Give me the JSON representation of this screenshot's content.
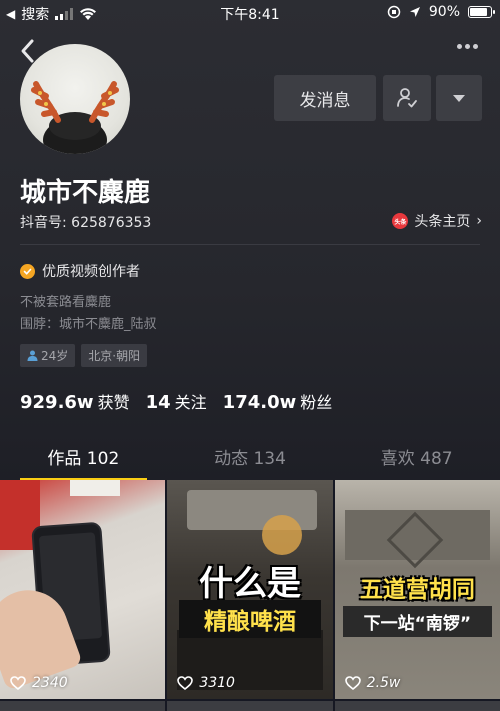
{
  "status_bar": {
    "left_label": "搜索",
    "time": "下午8:41",
    "battery_text": "90%",
    "battery_level": 0.9
  },
  "profile": {
    "nickname": "城市不麋鹿",
    "douyin_id": "抖音号: 625876353",
    "toutiao_label": "头条主页",
    "toutiao_logo_text": "头条",
    "verified_label": "优质视频创作者",
    "bio_line1": "不被套路看麋鹿",
    "bio_line2": "围脖：城市不麋鹿_陆叔",
    "tags": [
      "24岁",
      "北京·朝阳"
    ]
  },
  "actions": {
    "message_label": "发消息"
  },
  "stats": [
    {
      "num": "929.6w",
      "label": "获赞"
    },
    {
      "num": "14",
      "label": "关注"
    },
    {
      "num": "174.0w",
      "label": "粉丝"
    }
  ],
  "tabs": [
    {
      "label": "作品 102",
      "active": true
    },
    {
      "label": "动态 134",
      "active": false
    },
    {
      "label": "喜欢 487",
      "active": false
    }
  ],
  "videos": [
    {
      "likes": "2340",
      "title_line1": "",
      "title_line2": ""
    },
    {
      "likes": "3310",
      "title_line1": "什么是",
      "title_line2": "精酿啤酒"
    },
    {
      "likes": "2.5w",
      "title_line1": "五道营胡同",
      "title_line2": "下一站“南锣”"
    }
  ],
  "colors": {
    "accent": "#face15",
    "background": "#161823",
    "verified": "#f5a623",
    "toutiao": "#e8383d"
  },
  "icons": [
    "back-icon",
    "more-icon",
    "follow-user-icon",
    "dropdown-icon",
    "heart-icon",
    "location-icon",
    "wifi-icon"
  ]
}
